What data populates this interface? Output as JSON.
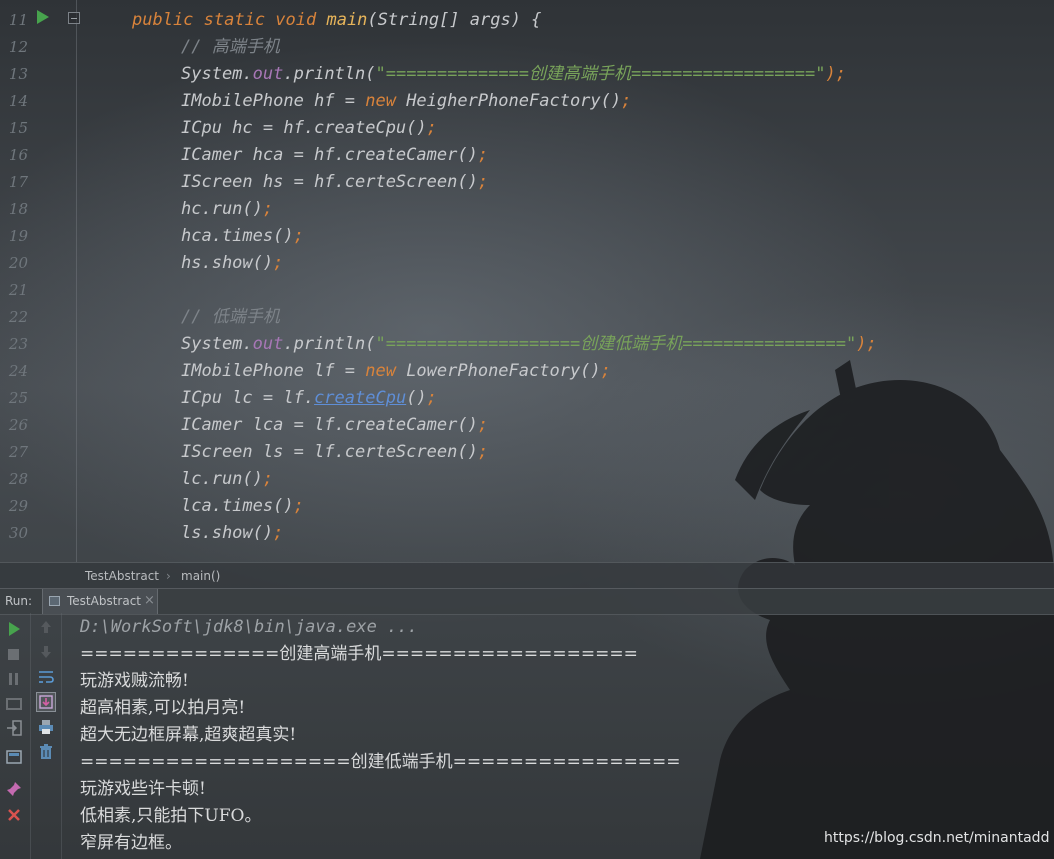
{
  "editor": {
    "line_numbers": [
      "11",
      "12",
      "13",
      "14",
      "15",
      "16",
      "17",
      "18",
      "19",
      "20",
      "21",
      "22",
      "23",
      "24",
      "25",
      "26",
      "27",
      "28",
      "29",
      "30"
    ],
    "lines": [
      {
        "parts": [
          {
            "t": "public static void ",
            "c": "kw"
          },
          {
            "t": "main",
            "c": "fn"
          },
          {
            "t": "(String[] args) {",
            "c": ""
          }
        ]
      },
      {
        "indent": 1,
        "parts": [
          {
            "t": "// 高端手机",
            "c": "cmt"
          }
        ]
      },
      {
        "indent": 1,
        "parts": [
          {
            "t": "System.",
            "c": ""
          },
          {
            "t": "out",
            "c": "fld"
          },
          {
            "t": ".println(",
            "c": ""
          },
          {
            "t": "\"==============创建高端手机==================\"",
            "c": "str"
          },
          {
            "t": ");",
            "c": "kw"
          }
        ]
      },
      {
        "indent": 1,
        "parts": [
          {
            "t": "IMobilePhone hf = ",
            "c": ""
          },
          {
            "t": "new ",
            "c": "kw"
          },
          {
            "t": "HeigherPhoneFactory()",
            "c": ""
          },
          {
            "t": ";",
            "c": "kw"
          }
        ]
      },
      {
        "indent": 1,
        "parts": [
          {
            "t": "ICpu hc = hf.createCpu()",
            "c": ""
          },
          {
            "t": ";",
            "c": "kw"
          }
        ]
      },
      {
        "indent": 1,
        "parts": [
          {
            "t": "ICamer hca = hf.createCamer()",
            "c": ""
          },
          {
            "t": ";",
            "c": "kw"
          }
        ]
      },
      {
        "indent": 1,
        "parts": [
          {
            "t": "IScreen hs = hf.certeScreen()",
            "c": ""
          },
          {
            "t": ";",
            "c": "kw"
          }
        ]
      },
      {
        "indent": 1,
        "parts": [
          {
            "t": "hc.run()",
            "c": ""
          },
          {
            "t": ";",
            "c": "kw"
          }
        ]
      },
      {
        "indent": 1,
        "parts": [
          {
            "t": "hca.times()",
            "c": ""
          },
          {
            "t": ";",
            "c": "kw"
          }
        ]
      },
      {
        "indent": 1,
        "parts": [
          {
            "t": "hs.show()",
            "c": ""
          },
          {
            "t": ";",
            "c": "kw"
          }
        ]
      },
      {
        "indent": 1,
        "parts": []
      },
      {
        "indent": 1,
        "parts": [
          {
            "t": "// 低端手机",
            "c": "cmt"
          }
        ]
      },
      {
        "indent": 1,
        "parts": [
          {
            "t": "System.",
            "c": ""
          },
          {
            "t": "out",
            "c": "fld"
          },
          {
            "t": ".println(",
            "c": ""
          },
          {
            "t": "\"===================创建低端手机================\"",
            "c": "str"
          },
          {
            "t": ");",
            "c": "kw"
          }
        ]
      },
      {
        "indent": 1,
        "parts": [
          {
            "t": "IMobilePhone lf = ",
            "c": ""
          },
          {
            "t": "new ",
            "c": "kw"
          },
          {
            "t": "LowerPhoneFactory()",
            "c": ""
          },
          {
            "t": ";",
            "c": "kw"
          }
        ]
      },
      {
        "indent": 1,
        "parts": [
          {
            "t": "ICpu lc = lf.",
            "c": ""
          },
          {
            "t": "createCpu",
            "c": "link"
          },
          {
            "t": "()",
            "c": ""
          },
          {
            "t": ";",
            "c": "kw"
          }
        ]
      },
      {
        "indent": 1,
        "parts": [
          {
            "t": "ICamer lca = lf.createCamer()",
            "c": ""
          },
          {
            "t": ";",
            "c": "kw"
          }
        ]
      },
      {
        "indent": 1,
        "parts": [
          {
            "t": "IScreen ls = lf.certeScreen()",
            "c": ""
          },
          {
            "t": ";",
            "c": "kw"
          }
        ]
      },
      {
        "indent": 1,
        "parts": [
          {
            "t": "lc.run()",
            "c": ""
          },
          {
            "t": ";",
            "c": "kw"
          }
        ]
      },
      {
        "indent": 1,
        "parts": [
          {
            "t": "lca.times()",
            "c": ""
          },
          {
            "t": ";",
            "c": "kw"
          }
        ]
      },
      {
        "indent": 1,
        "parts": [
          {
            "t": "ls.show()",
            "c": ""
          },
          {
            "t": ";",
            "c": "kw"
          }
        ]
      }
    ]
  },
  "breadcrumb": {
    "class_name": "TestAbstract",
    "separator": "›",
    "method": "main()"
  },
  "run_panel": {
    "label": "Run:",
    "tab_label": "TestAbstract",
    "tab_close": "×",
    "command": "D:\\WorkSoft\\jdk8\\bin\\java.exe ...",
    "output": [
      "==============创建高端手机==================",
      "玩游戏贼流畅!",
      "超高相素,可以拍月亮!",
      "超大无边框屏幕,超爽超真实!",
      "===================创建低端手机================",
      "玩游戏些许卡顿!",
      "低相素,只能拍下UFO。",
      "窄屏有边框。"
    ]
  },
  "watermark": "https://blog.csdn.net/minantadd",
  "colors": {
    "keyword": "#d8833b",
    "method": "#e6b45a",
    "field": "#a777b6",
    "string": "#78a35a",
    "comment": "#7d8389",
    "link": "#5f8ed6",
    "run_green": "#47a34d",
    "stop_red": "#d9534f"
  }
}
